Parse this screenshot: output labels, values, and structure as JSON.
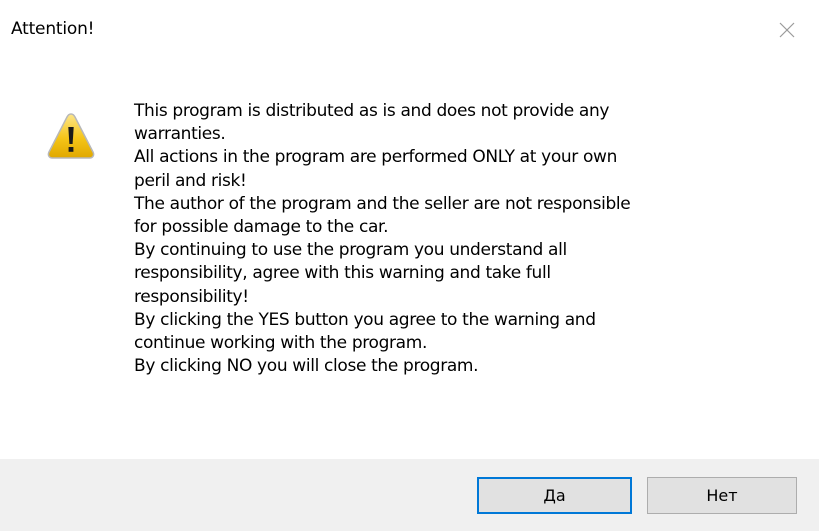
{
  "dialog": {
    "title": "Attention!",
    "close_icon": "close-icon",
    "warning_icon": "warning-icon",
    "message_lines": [
      "This program is distributed as is and does not provide any",
      "warranties.",
      "All actions in the program are performed ONLY at your own",
      "peril and risk!",
      "The author of the program and the seller are not responsible",
      "for possible damage to the car.",
      "By continuing to use the program you understand all",
      "responsibility, agree with this warning and take full",
      "responsibility!",
      "By clicking the YES button you agree to the warning and",
      "continue working with the program.",
      "By clicking NO you will close the program."
    ],
    "yes_label": "Да",
    "no_label": "Нет",
    "colors": {
      "footer_bg": "#f0f0f0",
      "button_bg": "#e1e1e1",
      "focus_border": "#0078d7",
      "warning_yellow": "#f5c518"
    }
  }
}
